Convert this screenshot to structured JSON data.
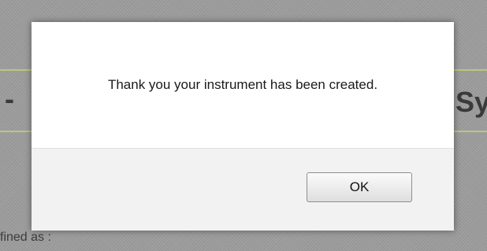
{
  "background_page": {
    "title_left": "-",
    "title_right": "Sy",
    "partial_text": "fined as :"
  },
  "dialog": {
    "message": "Thank you your instrument has been created.",
    "ok_label": "OK"
  }
}
